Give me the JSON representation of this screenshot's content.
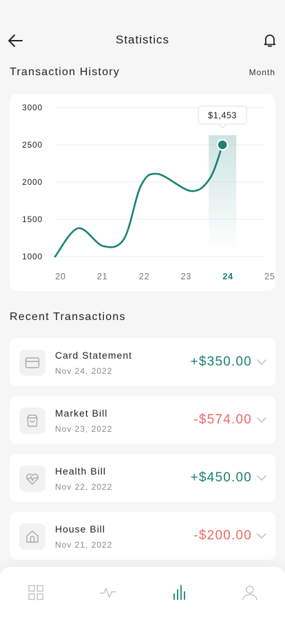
{
  "header": {
    "title": "Statistics"
  },
  "history": {
    "title": "Transaction History",
    "period": "Month"
  },
  "chart_data": {
    "type": "line",
    "y_ticks": [
      "3000",
      "2500",
      "2000",
      "1500",
      "1000"
    ],
    "ylim": [
      1000,
      3000
    ],
    "x_ticks": [
      "20",
      "21",
      "22",
      "23",
      "24",
      "25"
    ],
    "selected_x": "24",
    "selected_value": 2500,
    "tooltip": "$1,453",
    "series": [
      {
        "points": [
          {
            "x": 20.0,
            "y": 1000
          },
          {
            "x": 20.55,
            "y": 1380
          },
          {
            "x": 21.15,
            "y": 1140
          },
          {
            "x": 21.65,
            "y": 1240
          },
          {
            "x": 22.05,
            "y": 1950
          },
          {
            "x": 22.45,
            "y": 2110
          },
          {
            "x": 23.25,
            "y": 1880
          },
          {
            "x": 23.7,
            "y": 2050
          },
          {
            "x": 24.0,
            "y": 2500
          }
        ]
      }
    ],
    "colors": {
      "line": "#1a8272",
      "selected_tick": "#1a8272",
      "tick": "#777777",
      "grid": "#eeeeee"
    }
  },
  "recent": {
    "title": "Recent Transactions",
    "items": [
      {
        "name": "Card Statement",
        "date": "Nov 24, 2022",
        "amount": "+$350.00",
        "kind": "income",
        "icon": "card-icon"
      },
      {
        "name": "Market Bill",
        "date": "Nov 23, 2022",
        "amount": "-$574.00",
        "kind": "expense",
        "icon": "bag-icon"
      },
      {
        "name": "Health Bill",
        "date": "Nov 22, 2022",
        "amount": "+$450.00",
        "kind": "income",
        "icon": "heart-pulse-icon"
      },
      {
        "name": "House Bill",
        "date": "Nov 21, 2022",
        "amount": "-$200.00",
        "kind": "expense",
        "icon": "house-icon"
      }
    ]
  },
  "colors": {
    "income": "#1a8272",
    "expense": "#ec6a67",
    "nav_active": "#1a8272",
    "nav_inactive": "#c9c9c9"
  },
  "nav": {
    "items": [
      {
        "icon": "grid-icon",
        "active": false
      },
      {
        "icon": "activity-icon",
        "active": false
      },
      {
        "icon": "bar-chart-icon",
        "active": true
      },
      {
        "icon": "user-icon",
        "active": false
      }
    ]
  }
}
